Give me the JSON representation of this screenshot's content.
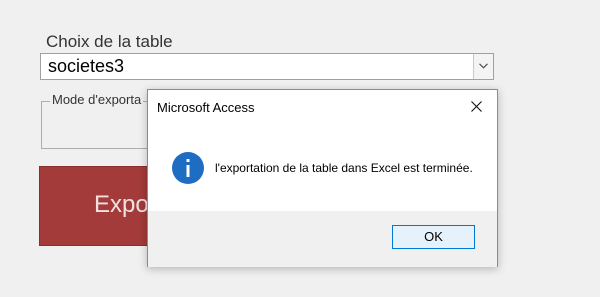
{
  "form": {
    "table_label": "Choix de la table",
    "table_value": "societes3",
    "mode_label": "Mode d'exporta",
    "export_label": "Expor"
  },
  "dialog": {
    "title": "Microsoft Access",
    "message": "l'exportation de la table dans Excel est terminée.",
    "ok_label": "OK",
    "icon": "info-icon",
    "close_icon": "close-icon"
  },
  "colors": {
    "export_button": "#a33b3a",
    "info_icon": "#1f6dc2",
    "ok_border": "#0078d7"
  }
}
